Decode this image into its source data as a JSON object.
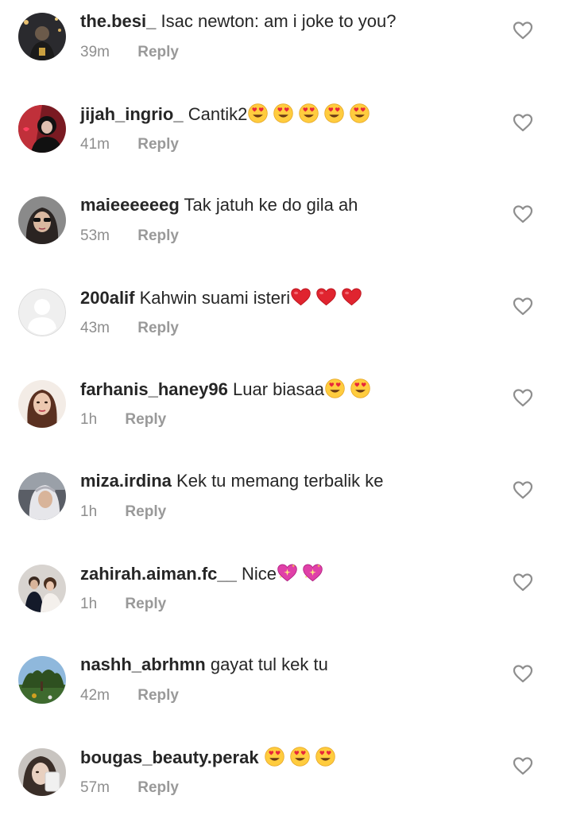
{
  "comments": [
    {
      "username": "the.besi_",
      "body": "Isac newton: am i joke to you?",
      "emojis": [],
      "time": "39m",
      "reply_label": "Reply"
    },
    {
      "username": "jijah_ingrio_",
      "body": "Cantik2",
      "emojis": [
        "smiling-face-with-heart-eyes",
        "smiling-face-with-heart-eyes",
        "smiling-face-with-heart-eyes",
        "smiling-face-with-heart-eyes",
        "smiling-face-with-heart-eyes"
      ],
      "time": "41m",
      "reply_label": "Reply"
    },
    {
      "username": "maieeeeeeg",
      "body": "Tak jatuh ke do gila ah",
      "emojis": [],
      "time": "53m",
      "reply_label": "Reply"
    },
    {
      "username": "200alif",
      "body": "Kahwin suami isteri",
      "emojis": [
        "red-heart",
        "red-heart",
        "red-heart"
      ],
      "time": "43m",
      "reply_label": "Reply"
    },
    {
      "username": "farhanis_haney96",
      "body": "Luar biasaa",
      "emojis": [
        "smiling-face-with-heart-eyes",
        "smiling-face-with-heart-eyes"
      ],
      "time": "1h",
      "reply_label": "Reply"
    },
    {
      "username": "miza.irdina",
      "body": "Kek tu memang terbalik ke",
      "emojis": [],
      "time": "1h",
      "reply_label": "Reply"
    },
    {
      "username": "zahirah.aiman.fc__",
      "body": "Nice",
      "emojis": [
        "sparkling-heart",
        "sparkling-heart"
      ],
      "time": "1h",
      "reply_label": "Reply"
    },
    {
      "username": "nashh_abrhmn",
      "body": "gayat tul kek tu",
      "emojis": [],
      "time": "42m",
      "reply_label": "Reply"
    },
    {
      "username": "bougas_beauty.perak",
      "body": "",
      "emojis": [
        "smiling-face-with-heart-eyes",
        "smiling-face-with-heart-eyes",
        "smiling-face-with-heart-eyes"
      ],
      "time": "57m",
      "reply_label": "Reply"
    }
  ],
  "icons": {
    "like": "heart-outline-icon"
  },
  "colors": {
    "text": "#262626",
    "secondary_text": "#8e8e8e",
    "reply_text": "#999999",
    "background": "#ffffff"
  }
}
